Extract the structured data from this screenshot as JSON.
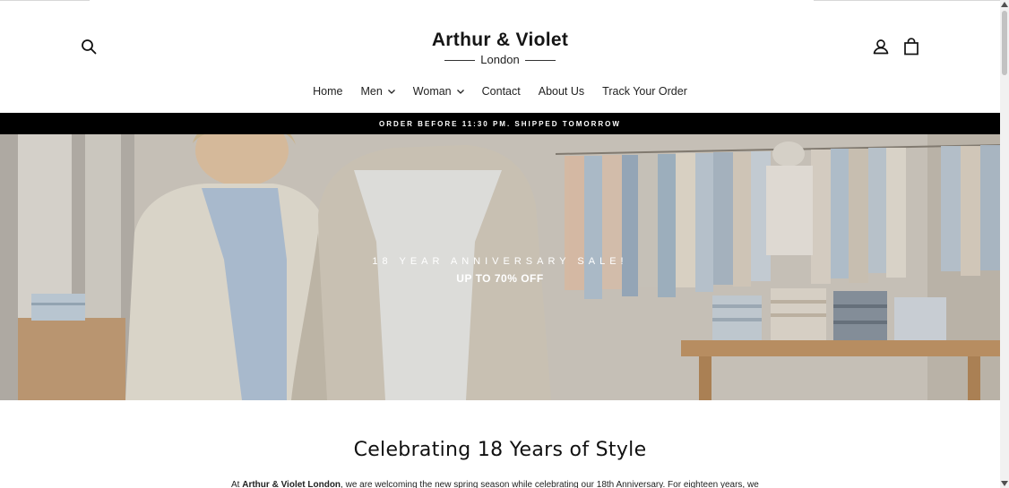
{
  "brand": {
    "name": "Arthur & Violet",
    "location": "London"
  },
  "header": {
    "icons": {
      "search": "search-icon",
      "account": "user-icon",
      "cart": "shopping-bag-icon"
    }
  },
  "nav": {
    "items": [
      {
        "label": "Home",
        "has_dropdown": false
      },
      {
        "label": "Men",
        "has_dropdown": true
      },
      {
        "label": "Woman",
        "has_dropdown": true
      },
      {
        "label": "Contact",
        "has_dropdown": false
      },
      {
        "label": "About Us",
        "has_dropdown": false
      },
      {
        "label": "Track Your Order",
        "has_dropdown": false
      }
    ]
  },
  "announcement": {
    "text": "ORDER BEFORE 11:30 PM. SHIPPED TOMORROW"
  },
  "hero": {
    "kicker": "18 YEAR ANNIVERSARY SALE!",
    "headline": "UP TO 70% OFF"
  },
  "section": {
    "title": "Celebrating 18 Years of Style",
    "body_prefix": "At ",
    "body_brand": "Arthur & Violet London",
    "body_rest": ", we are welcoming the new spring season while celebrating our 18th Anniversary. For eighteen years, we"
  },
  "colors": {
    "announcement_bg": "#000000",
    "text": "#111111",
    "background": "#ffffff"
  }
}
